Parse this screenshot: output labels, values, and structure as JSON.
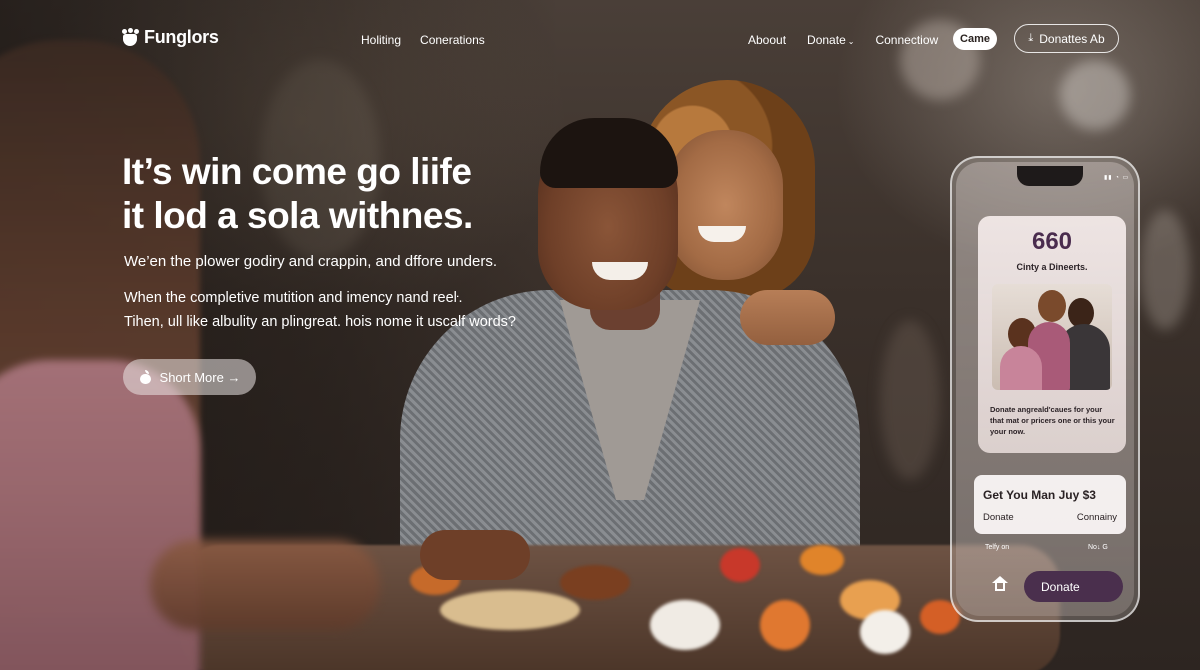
{
  "nav": {
    "logo_text": "Funglors",
    "center_links": [
      "Holiting",
      "Conerations"
    ],
    "right_links": [
      "Aboout",
      "Donate",
      "Connectiow"
    ],
    "came_button": "Came",
    "donates_button": "Donattes Ab"
  },
  "hero": {
    "title_line1": "It’s win come go liife",
    "title_line2": "it lod a sola withnes.",
    "subtitle": "We’en the plower godiry and crappin, and dffore unders.",
    "para_line1": "When the completive mutition and imency nand reeŀ.",
    "para_line2": "Tihen, ull like albulity an plingreat. hois nome it uscalf words?",
    "cta": "Short More →"
  },
  "phone": {
    "stat_number": "660",
    "stat_caption": "Cinty a Dineerts.",
    "card_text": "Donate angreald'caues for your that mat or pricers one or this your your now.",
    "offer_title": "Get You Man Juy $3",
    "offer_left": "Donate",
    "offer_right": "Connainy",
    "footer_left": "Telfy on",
    "footer_right": "No↓ G",
    "donate_button": "Donate"
  },
  "colors": {
    "donate_button": "#4a2f4d",
    "stat_number": "#4a2c4e"
  }
}
